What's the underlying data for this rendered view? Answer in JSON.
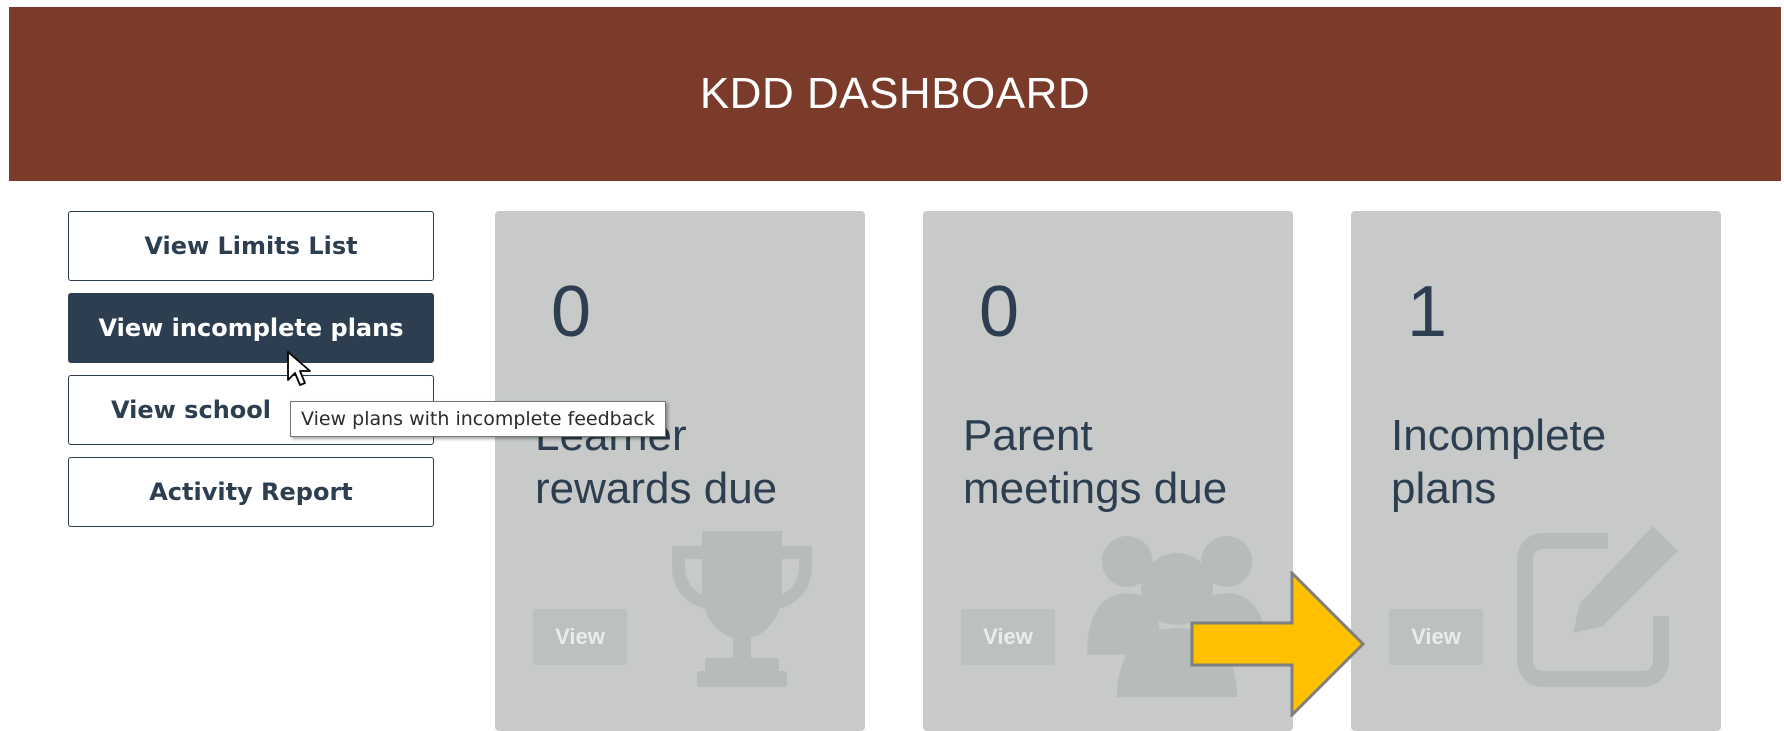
{
  "header": {
    "title": "KDD DASHBOARD",
    "background": "#7a3b2a"
  },
  "sidebar": {
    "buttons": [
      {
        "label": "View Limits List",
        "active": false
      },
      {
        "label": "View incomplete plans",
        "active": true
      },
      {
        "label": "View school",
        "active": false
      },
      {
        "label": "Activity Report",
        "active": false
      }
    ]
  },
  "tooltip": {
    "text": "View plans with incomplete feedback"
  },
  "cards": [
    {
      "count": "0",
      "label": "Learner rewards due",
      "icon": "trophy-icon",
      "button": "View"
    },
    {
      "count": "0",
      "label": "Parent meetings due",
      "icon": "users-icon",
      "button": "View"
    },
    {
      "count": "1",
      "label": "Incomplete plans",
      "icon": "edit-icon",
      "button": "View"
    }
  ],
  "colors": {
    "navy": "#2c3e50",
    "card_bg": "#c7cac9",
    "arrow_fill": "#ffc000"
  }
}
